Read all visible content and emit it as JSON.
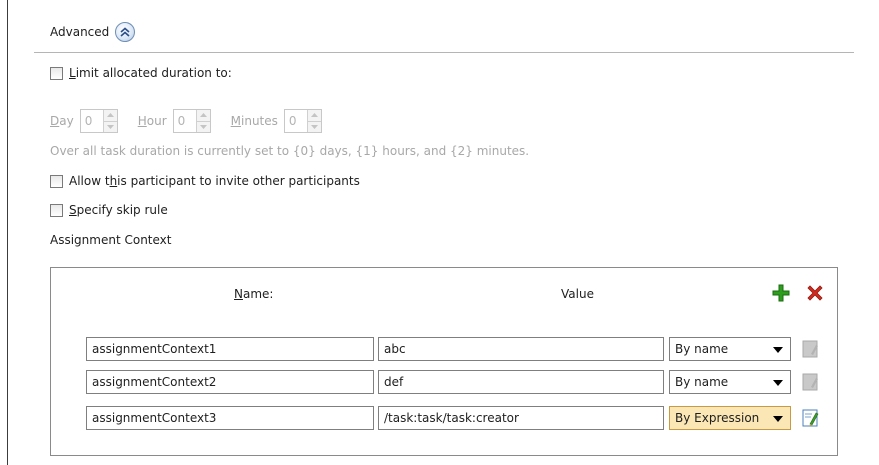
{
  "advanced": {
    "label": "Advanced"
  },
  "limit_duration": {
    "label": "Limit allocated duration to:",
    "checked": false,
    "underline_char": "L"
  },
  "duration": {
    "day_label": "Day",
    "day_value": "0",
    "hour_label": "Hour",
    "hour_value": "0",
    "minutes_label": "Minutes",
    "minutes_value": "0",
    "note": "Over all task duration is currently set to {0} days, {1} hours, and {2} minutes."
  },
  "invite": {
    "label_pre": "Allow t",
    "label_ul": "h",
    "label_post": "is participant to invite other participants",
    "checked": false
  },
  "skip": {
    "label_ul": "S",
    "label_post": "pecify skip rule",
    "checked": false
  },
  "assignment_context": {
    "label": "Assignment Context",
    "name_header_ul": "N",
    "name_header_rest": "ame:",
    "value_header": "Value",
    "rows": [
      {
        "name": "assignmentContext1",
        "value": "abc",
        "type": "By name",
        "highlighted": false
      },
      {
        "name": "assignmentContext2",
        "value": "def",
        "type": "By name",
        "highlighted": false
      },
      {
        "name": "assignmentContext3",
        "value": "/task:task/task:creator",
        "type": "By Expression",
        "highlighted": true
      }
    ]
  },
  "icons": {
    "collapse": "double-chevron-up-icon",
    "add": "green-plus-icon",
    "delete": "red-x-icon",
    "edit_disabled": "edit-disabled-icon",
    "edit_enabled": "edit-expression-icon"
  },
  "colors": {
    "add": "#2e9e1e",
    "delete": "#d42b1e",
    "highlight_select": "#fbe7b6"
  }
}
